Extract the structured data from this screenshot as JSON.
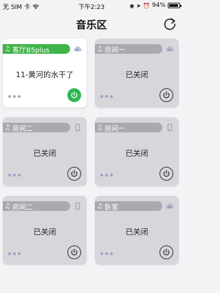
{
  "status_bar": {
    "carrier": "无 SIM 卡",
    "time": "下午2:23",
    "battery_percent": "94%",
    "battery_level": 0.94
  },
  "nav": {
    "title": "音乐区"
  },
  "zones": [
    {
      "name": "客厅B5plus",
      "status": "11-黄河的水干了",
      "active": true,
      "device_icon": "cloud-speaker-icon"
    },
    {
      "name": "房间一",
      "status": "已关闭",
      "active": false,
      "device_icon": "cloud-speaker-icon"
    },
    {
      "name": "房间二",
      "status": "已关闭",
      "active": false,
      "device_icon": "phone-device-icon"
    },
    {
      "name": "房间一",
      "status": "已关闭",
      "active": false,
      "device_icon": "phone-device-icon"
    },
    {
      "name": "房间二",
      "status": "已关闭",
      "active": false,
      "device_icon": "phone-device-icon"
    },
    {
      "name": "卧室",
      "status": "已关闭",
      "active": false,
      "device_icon": "cloud-speaker-icon"
    }
  ],
  "colors": {
    "active_green": "#3fb449",
    "inactive_tag": "#a9a9ae",
    "inactive_card": "#d6d6db"
  }
}
